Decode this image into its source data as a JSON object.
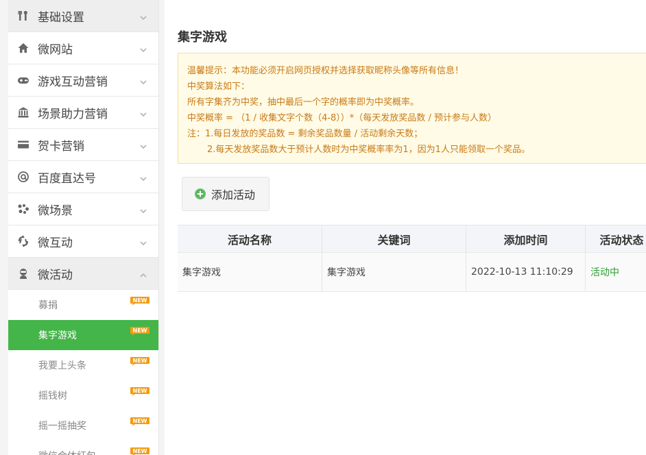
{
  "sidebar": {
    "menu": [
      {
        "label": "基础设置",
        "icon": "tools-icon"
      },
      {
        "label": "微网站",
        "icon": "home-icon"
      },
      {
        "label": "游戏互动营销",
        "icon": "gamepad-icon"
      },
      {
        "label": "场景助力营销",
        "icon": "bank-icon"
      },
      {
        "label": "贺卡营销",
        "icon": "card-icon"
      },
      {
        "label": "百度直达号",
        "icon": "at-icon"
      },
      {
        "label": "微场景",
        "icon": "scene-icon"
      },
      {
        "label": "微互动",
        "icon": "interact-icon"
      },
      {
        "label": "微活动",
        "icon": "activity-icon"
      }
    ],
    "sub_items": [
      {
        "label": "募捐",
        "badge": "NEW"
      },
      {
        "label": "集字游戏",
        "badge": "NEW"
      },
      {
        "label": "我要上头条",
        "badge": "NEW"
      },
      {
        "label": "摇钱树",
        "badge": "NEW"
      },
      {
        "label": "摇一摇抽奖",
        "badge": "NEW"
      },
      {
        "label": "微信合体红包",
        "badge": "NEW"
      }
    ]
  },
  "main": {
    "title": "集字游戏",
    "notice": [
      "温馨提示：本功能必须开启网页授权并选择获取昵称头像等所有信息！",
      "中奖算法如下：",
      "所有字集齐为中奖，抽中最后一个字的概率即为中奖概率。",
      "中奖概率 = （1 / 收集文字个数（4-8））*（每天发放奖品数 / 预计参与人数）",
      "注：1.每日发放的奖品数 = 剩余奖品数量 / 活动剩余天数；",
      "2.每天发放奖品数大于预计人数时为中奖概率率为1，因为1人只能领取一个奖品。"
    ],
    "add_button": "添加活动",
    "table": {
      "headers": [
        "活动名称",
        "关键词",
        "添加时间",
        "活动状态"
      ],
      "rows": [
        {
          "name": "集字游戏",
          "keyword": "集字游戏",
          "time": "2022-10-13 11:10:29",
          "status": "活动中"
        }
      ]
    }
  },
  "colors": {
    "accent_green": "#44b549",
    "notice_bg": "#fffbe6",
    "notice_text": "#c97a16",
    "badge_orange": "#f39c12",
    "status_green": "#2a9d2f"
  }
}
